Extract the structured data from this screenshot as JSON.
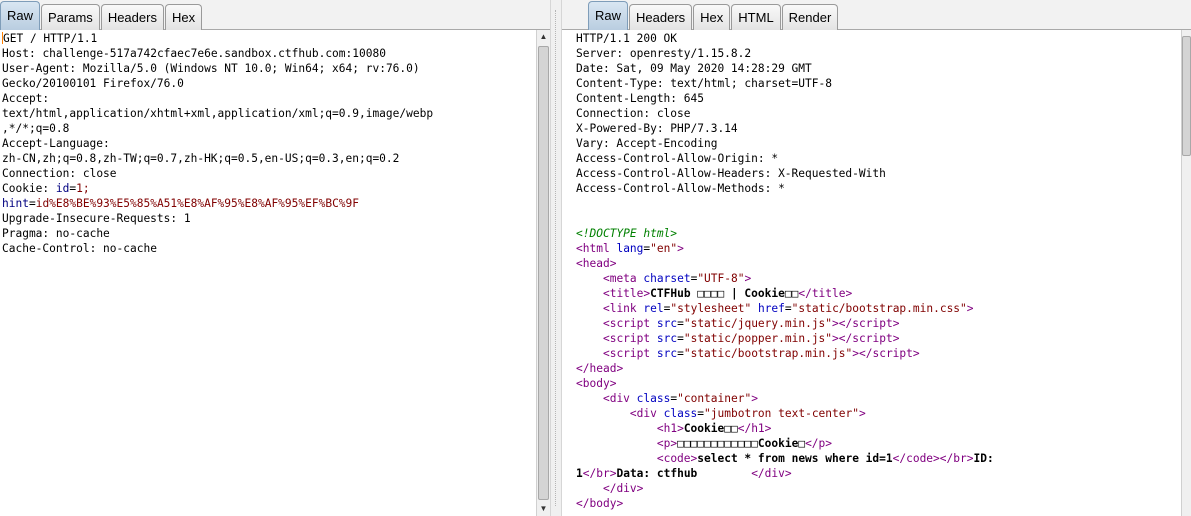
{
  "request": {
    "tabs": [
      {
        "label": "Raw"
      },
      {
        "label": "Params"
      },
      {
        "label": "Headers"
      },
      {
        "label": "Hex"
      }
    ],
    "active_tab": "Raw",
    "request_line": "GET / HTTP/1.1",
    "headers": [
      {
        "name": "Host",
        "value": "challenge-517a742cfaec7e6e.sandbox.ctfhub.com:10080"
      },
      {
        "name": "User-Agent",
        "value": "Mozilla/5.0 (Windows NT 10.0; Win64; x64; rv:76.0)"
      },
      {
        "name": "",
        "value": "Gecko/20100101 Firefox/76.0"
      },
      {
        "name": "Accept",
        "value": ""
      },
      {
        "name": "",
        "value": "text/html,application/xhtml+xml,application/xml;q=0.9,image/webp"
      },
      {
        "name": "",
        "value": ",*/*;q=0.8"
      },
      {
        "name": "Accept-Language",
        "value": ""
      },
      {
        "name": "",
        "value": "zh-CN,zh;q=0.8,zh-TW;q=0.7,zh-HK;q=0.5,en-US;q=0.3,en;q=0.2"
      },
      {
        "name": "Connection",
        "value": "close"
      },
      {
        "name": "Cookie",
        "value": "",
        "cookie_name": "id",
        "cookie_value": "1;"
      },
      {
        "name": "",
        "value": "",
        "cookie_name": "hint",
        "cookie_value": "id%E8%BE%93%E5%85%A51%E8%AF%95%E8%AF%95%EF%BC%9F"
      },
      {
        "name": "Upgrade-Insecure-Requests",
        "value": "1"
      },
      {
        "name": "Pragma",
        "value": "no-cache"
      },
      {
        "name": "Cache-Control",
        "value": "no-cache"
      }
    ]
  },
  "response": {
    "tabs": [
      {
        "label": "Raw"
      },
      {
        "label": "Headers"
      },
      {
        "label": "Hex"
      },
      {
        "label": "HTML"
      },
      {
        "label": "Render"
      }
    ],
    "active_tab": "Raw",
    "status_line": "HTTP/1.1 200 OK",
    "headers": [
      "Server: openresty/1.15.8.2",
      "Date: Sat, 09 May 2020 14:28:29 GMT",
      "Content-Type: text/html; charset=UTF-8",
      "Content-Length: 645",
      "Connection: close",
      "X-Powered-By: PHP/7.3.14",
      "Vary: Accept-Encoding",
      "Access-Control-Allow-Origin: *",
      "Access-Control-Allow-Headers: X-Requested-With",
      "Access-Control-Allow-Methods: *"
    ],
    "body": {
      "doctype": "<!DOCTYPE html>",
      "html_open": {
        "tag": "html",
        "attr": "lang",
        "val": "\"en\""
      },
      "head_open": "head",
      "meta": {
        "tag": "meta",
        "attr": "charset",
        "val": "\"UTF-8\""
      },
      "title": {
        "tag": "title",
        "text": "CTFHub □□□□ | Cookie□□"
      },
      "link": {
        "tag": "link",
        "attr1": "rel",
        "val1": "\"stylesheet\"",
        "attr2": "href",
        "val2": "\"static/bootstrap.min.css\""
      },
      "scripts": [
        {
          "tag": "script",
          "attr": "src",
          "val": "\"static/jquery.min.js\""
        },
        {
          "tag": "script",
          "attr": "src",
          "val": "\"static/popper.min.js\""
        },
        {
          "tag": "script",
          "attr": "src",
          "val": "\"static/bootstrap.min.js\""
        }
      ],
      "head_close": "head",
      "body_open": "body",
      "div_container": {
        "tag": "div",
        "attr": "class",
        "val": "\"container\""
      },
      "div_jumbo": {
        "tag": "div",
        "attr": "class",
        "val": "\"jumbotron text-center\""
      },
      "h1": {
        "tag": "h1",
        "text": "Cookie□□"
      },
      "p": {
        "tag": "p",
        "text": "□□□□□□□□□□□□Cookie□"
      },
      "code": {
        "tag": "code",
        "text": "select * from news where id=1",
        "br": "br",
        "after": "ID:"
      },
      "code_line2": {
        "start": "1",
        "br": "br",
        "after": "Data: ctfhub",
        "div_close": "div"
      },
      "div_close": "div",
      "body_close": "body"
    }
  }
}
